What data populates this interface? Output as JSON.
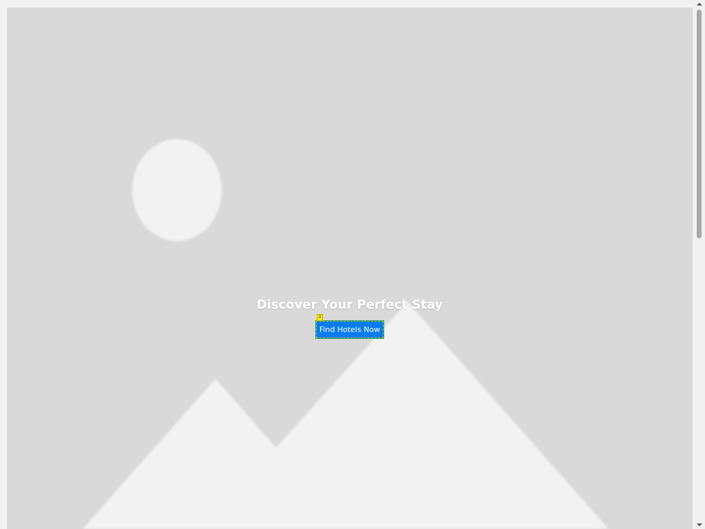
{
  "hero": {
    "title": "Discover Your Perfect Stay",
    "cta_label": "Find Hotels Now",
    "element_marker": "0",
    "image_icon": "image-placeholder-icon"
  },
  "colors": {
    "hero_background": "#d9d9d9",
    "placeholder_shapes": "#f2f2f2",
    "cta_background": "#0a7cf0",
    "cta_text": "#ffffff",
    "title_text": "#ffffff",
    "marker_background": "#f5e600"
  },
  "scrollbar": {
    "up_icon": "scroll-up-arrow-icon",
    "down_icon": "scroll-down-arrow-icon"
  }
}
